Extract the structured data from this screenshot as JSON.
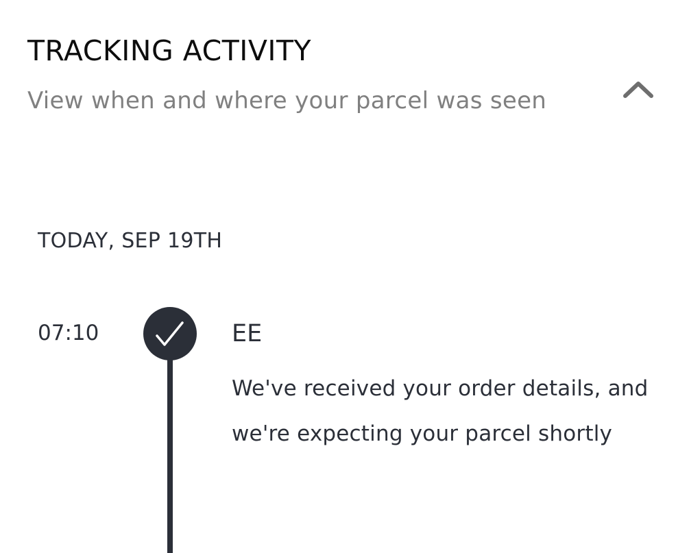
{
  "tracking": {
    "title": "TRACKING ACTIVITY",
    "subtitle": "View when and where your parcel was seen",
    "toggle_icon": "chevron-up-icon"
  },
  "timeline": {
    "date_header": "TODAY, SEP 19TH",
    "events": [
      {
        "time": "07:10",
        "carrier": "EE",
        "description": "We've received your order details, and we're expecting your parcel shortly",
        "status_icon": "check-icon"
      }
    ]
  },
  "colors": {
    "text_dark": "#2b2f38",
    "text_muted": "#808080",
    "timeline": "#2b2f38",
    "background": "#ffffff"
  }
}
